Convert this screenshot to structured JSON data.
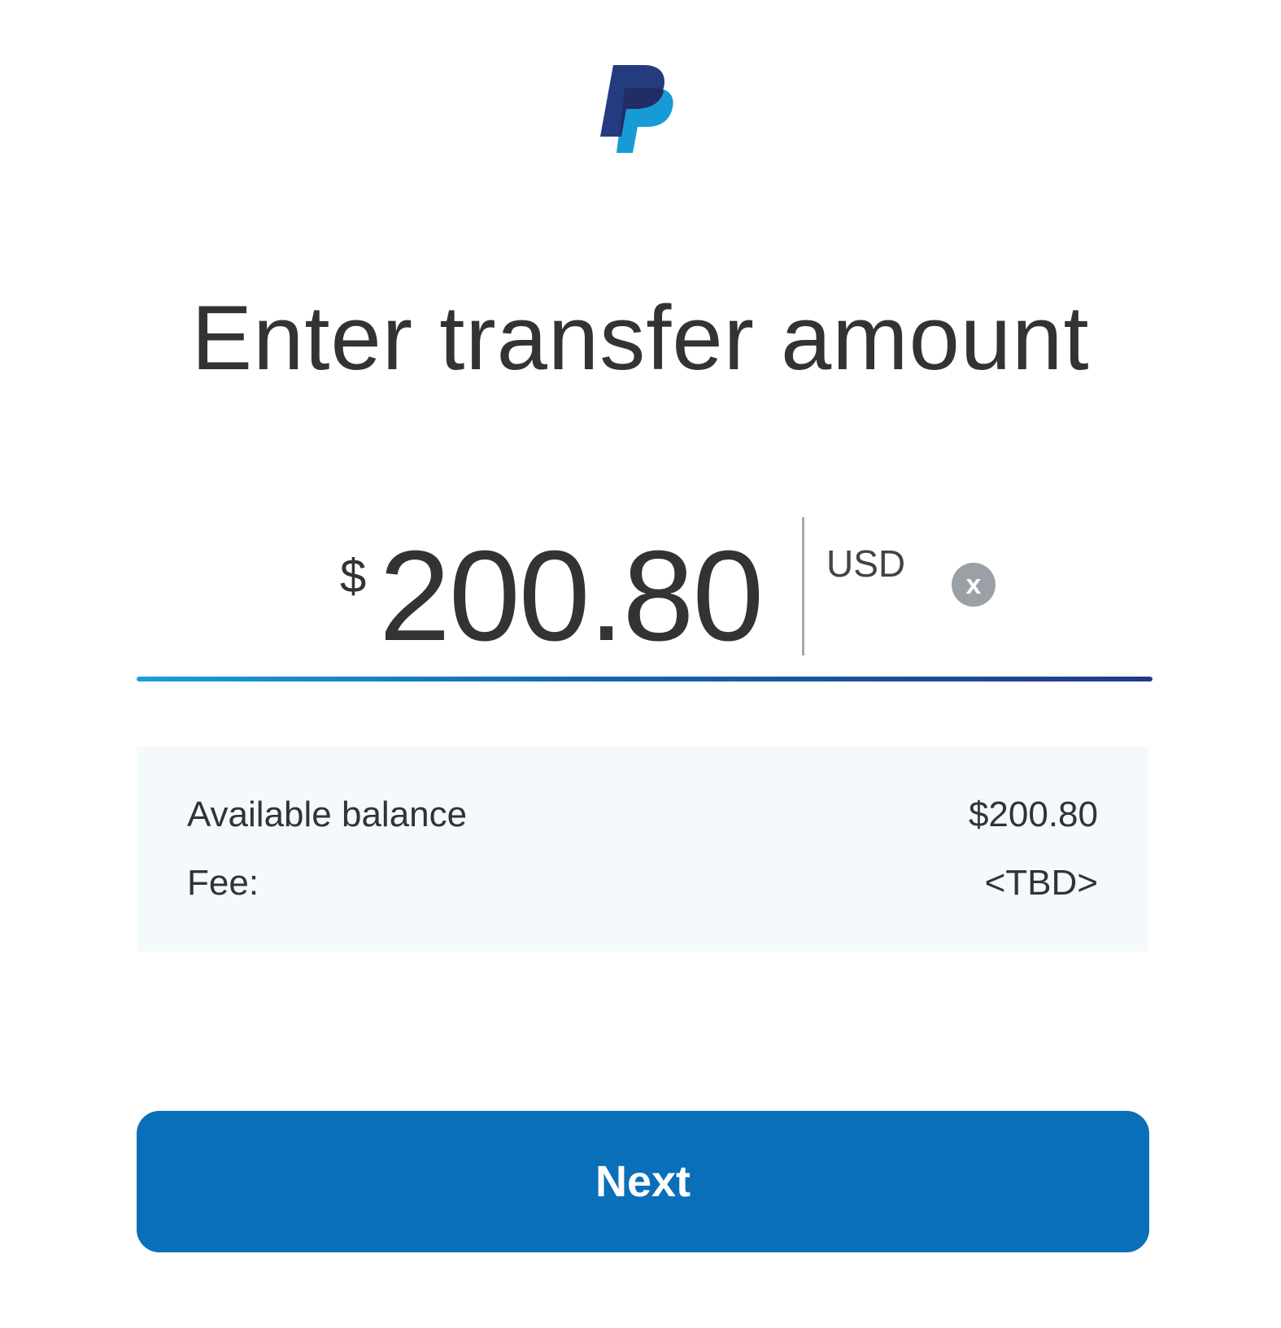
{
  "logo": {
    "icon": "paypal-logo-icon",
    "colors": {
      "dark": "#253b80",
      "light": "#179bd7",
      "overlap": "#222d65"
    }
  },
  "title": "Enter transfer amount",
  "amount": {
    "currency_symbol": "$",
    "value": "200.80",
    "currency_code": "USD",
    "clear_icon_text": "x"
  },
  "summary": {
    "available_balance_label": "Available balance",
    "available_balance_value": "$200.80",
    "fee_label": "Fee:",
    "fee_value": "<TBD>"
  },
  "next_button_label": "Next",
  "colors": {
    "accent": "#0a6fb9",
    "underline_start": "#1a9fd8",
    "underline_end": "#22398a",
    "panel_background": "#f4f9fc",
    "clear_icon_bg": "#9aa0a6",
    "text": "#333333"
  }
}
